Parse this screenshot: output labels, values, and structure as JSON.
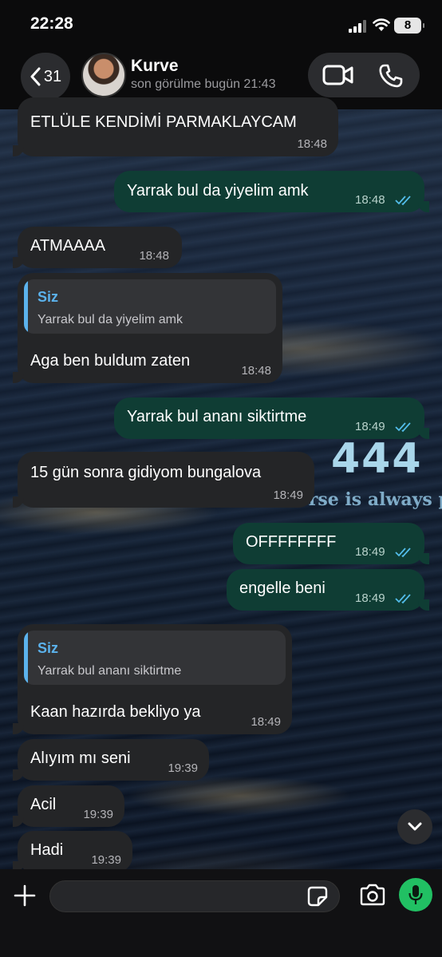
{
  "status_bar": {
    "time": "22:28",
    "battery": "8"
  },
  "header": {
    "back_count": "31",
    "contact_name": "Kurve",
    "last_seen": "son görülme bugün 21:43"
  },
  "wallpaper": {
    "overlay_number": "444",
    "overlay_text": "verse is always protecting me"
  },
  "messages": [
    {
      "dir": "in",
      "text": "ETLÜLE KENDİMİ PARMAKLAYCAM",
      "time": "18:48"
    },
    {
      "dir": "out",
      "text": "Yarrak bul da yiyelim amk",
      "time": "18:48"
    },
    {
      "dir": "in",
      "text": "ATMAAAA",
      "time": "18:48"
    },
    {
      "dir": "in",
      "quote_name": "Siz",
      "quote_text": "Yarrak bul da yiyelim amk",
      "text": "Aga ben buldum zaten",
      "time": "18:48"
    },
    {
      "dir": "out",
      "text": "Yarrak bul ananı siktirtme",
      "time": "18:49"
    },
    {
      "dir": "in",
      "text": "15 gün sonra gidiyom bungalova",
      "time": "18:49"
    },
    {
      "dir": "out",
      "text": "OFFFFFFFF",
      "time": "18:49"
    },
    {
      "dir": "out",
      "text": "engelle beni",
      "time": "18:49"
    },
    {
      "dir": "in",
      "quote_name": "Siz",
      "quote_text": "Yarrak bul ananı siktirtme",
      "text": "Kaan hazırda bekliyo ya",
      "time": "18:49"
    },
    {
      "dir": "in",
      "text": "Alıyım mı seni",
      "time": "19:39"
    },
    {
      "dir": "in",
      "text": "Acil",
      "time": "19:39"
    },
    {
      "dir": "in",
      "text": "Hadi",
      "time": "19:39"
    }
  ],
  "composer": {
    "placeholder": ""
  },
  "colors": {
    "incoming_bubble": "#242527",
    "outgoing_bubble": "#0f3d34",
    "quote_accent": "#5bb2ec",
    "read_ticks": "#53bdeb",
    "mic_button": "#21c063"
  },
  "icons": {
    "back": "chevron-left-icon",
    "video": "video-camera-icon",
    "phone": "phone-icon",
    "scroll": "chevron-down-icon",
    "plus": "plus-icon",
    "sticker": "sticker-icon",
    "camera": "camera-icon",
    "mic": "microphone-icon"
  }
}
